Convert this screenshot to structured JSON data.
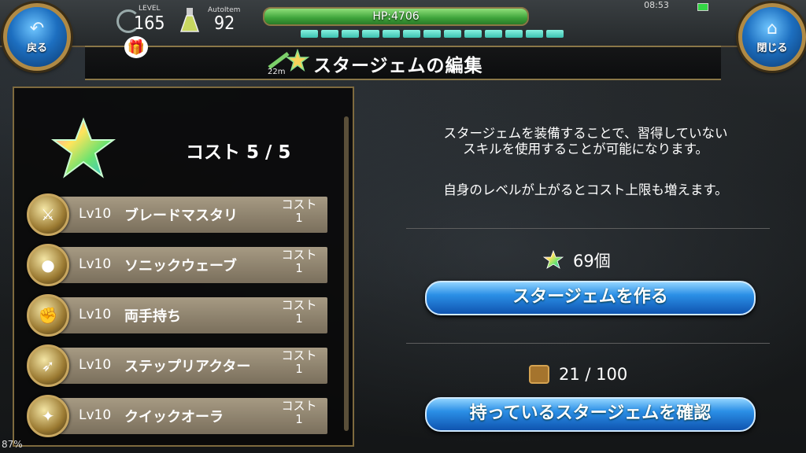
{
  "header": {
    "back_label": "戻る",
    "close_label": "閉じる",
    "level_caption": "LEVEL",
    "level_value": "165",
    "autoitem_caption": "AutoItem",
    "autoitem_value": "92",
    "hp_text": "HP:4706",
    "hp_ratio": 1.0,
    "time": "08:53",
    "segments": 13
  },
  "title": {
    "text": "スタージェムの編集",
    "distance": "22m"
  },
  "left": {
    "cost_label": "コスト 5 / 5",
    "skills": [
      {
        "level": "Lv10",
        "name": "ブレードマスタリ",
        "cost_label": "コスト",
        "cost": "1",
        "icon": "sword-icon"
      },
      {
        "level": "Lv10",
        "name": "ソニックウェーブ",
        "cost_label": "コスト",
        "cost": "1",
        "icon": "wave-icon"
      },
      {
        "level": "Lv10",
        "name": "両手持ち",
        "cost_label": "コスト",
        "cost": "1",
        "icon": "fist-icon"
      },
      {
        "level": "Lv10",
        "name": "ステップリアクター",
        "cost_label": "コスト",
        "cost": "1",
        "icon": "step-icon"
      },
      {
        "level": "Lv10",
        "name": "クイックオーラ",
        "cost_label": "コスト",
        "cost": "1",
        "icon": "aura-icon"
      }
    ]
  },
  "right": {
    "description_line1": "スタージェムを装備することで、習得していない",
    "description_line2": "スキルを使用することが可能になります。",
    "description_line3": "自身のレベルが上がるとコスト上限も増えます。",
    "gem_count": "69個",
    "make_button": "スタージェムを作る",
    "storage_count": "21 / 100",
    "check_button": "持っているスタージェムを確認"
  },
  "status": {
    "battery_percent": "87%"
  }
}
